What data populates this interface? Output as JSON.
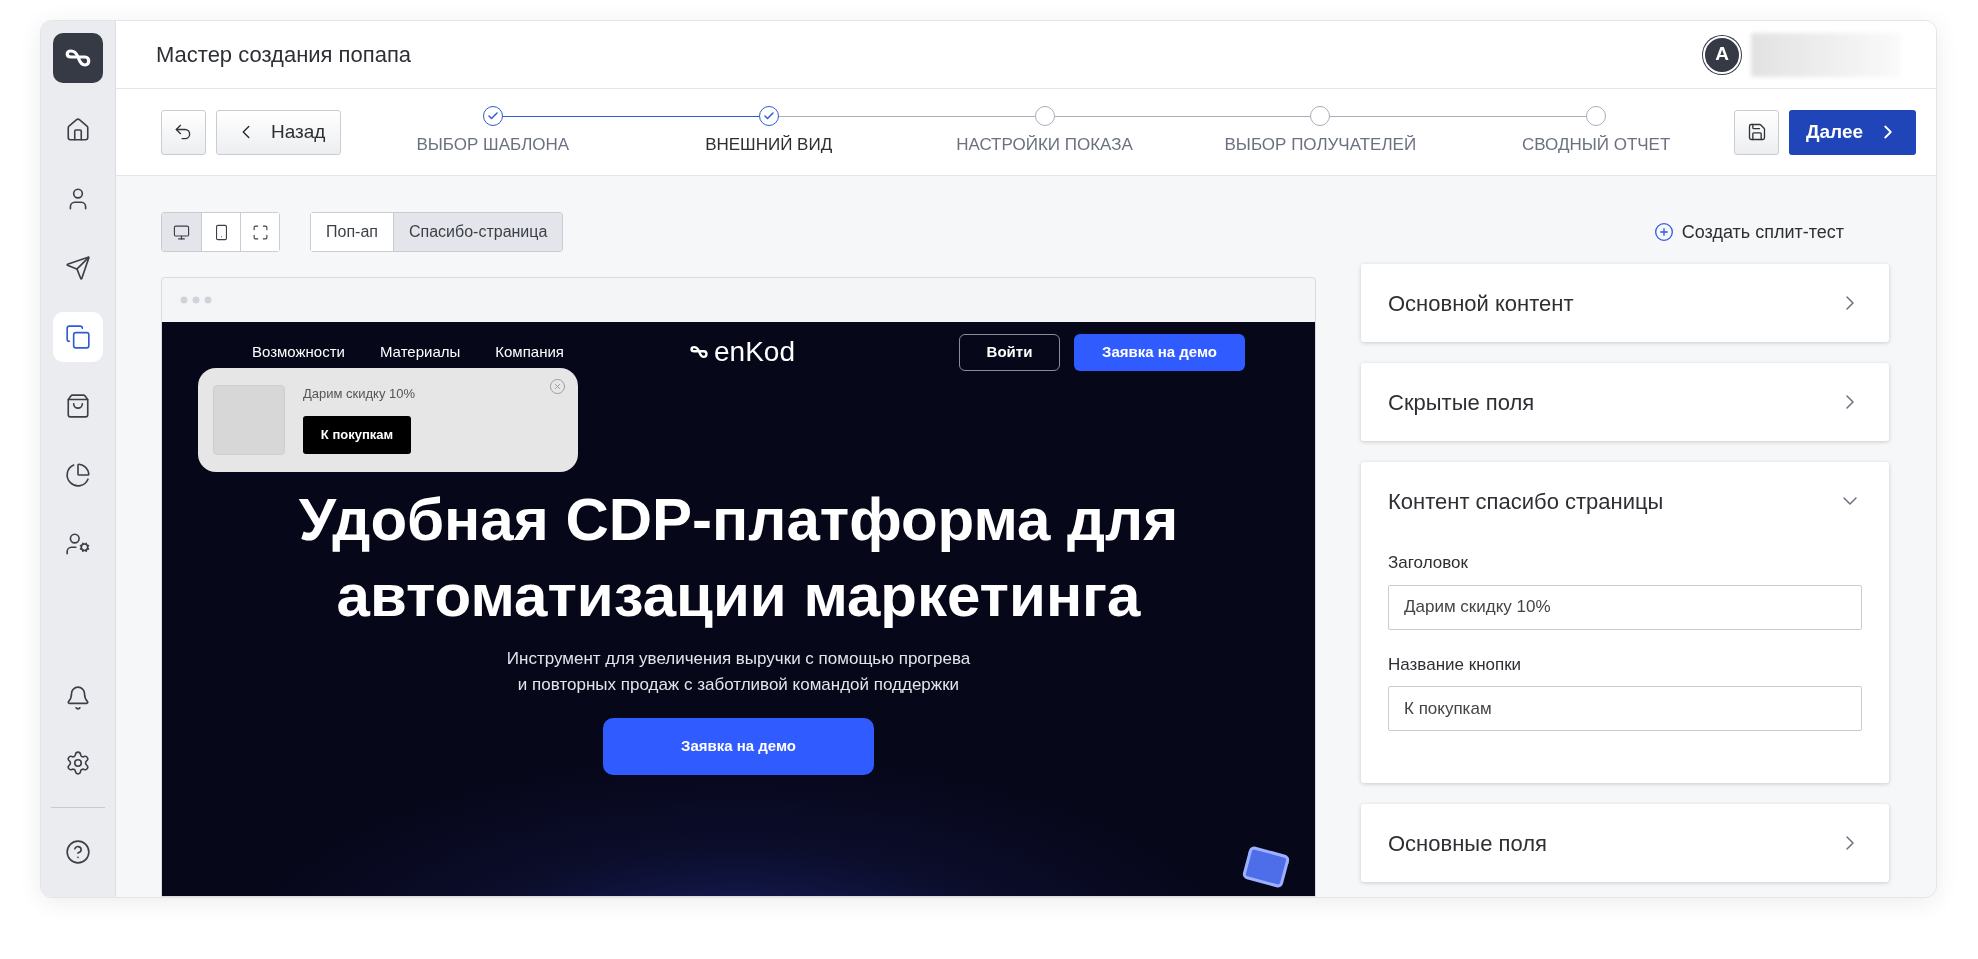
{
  "window": {
    "title": "Мастер создания попапа"
  },
  "user": {
    "avatar_letter": "A"
  },
  "sidebar": {
    "items": [
      {
        "selected": false
      },
      {
        "selected": false
      },
      {
        "selected": false
      },
      {
        "selected": true
      },
      {
        "selected": false
      },
      {
        "selected": false
      },
      {
        "selected": false
      }
    ],
    "bottom_items": [
      {
        "selected": false
      },
      {
        "selected": false
      },
      {
        "selected": false
      }
    ]
  },
  "toolbar": {
    "back_button": "Назад",
    "next_button": "Далее"
  },
  "steps": [
    {
      "label": "ВЫБОР ШАБЛОНА",
      "done": true,
      "selected": false
    },
    {
      "label": "ВНЕШНИЙ ВИД",
      "done": true,
      "selected": true
    },
    {
      "label": "НАСТРОЙКИ ПОКАЗА",
      "done": false,
      "selected": false
    },
    {
      "label": "ВЫБОР ПОЛУЧАТЕЛЕЙ",
      "done": false,
      "selected": false
    },
    {
      "label": "СВОДНЫЙ ОТЧЕТ",
      "done": false,
      "selected": false
    }
  ],
  "view_modes": [
    {
      "selected": true
    },
    {
      "selected": false
    },
    {
      "selected": false
    }
  ],
  "tabs": [
    {
      "label": "Поп-ап",
      "selected": false
    },
    {
      "label": "Спасибо-страница",
      "selected": true
    }
  ],
  "split_test_link": "Создать сплит-тест",
  "preview": {
    "nav_links": [
      "Возможности",
      "Материалы",
      "Компания"
    ],
    "logo": "enKod",
    "login_button": "Войти",
    "demo_button": "Заявка на демо",
    "popup": {
      "text": "Дарим скидку 10%",
      "button": "К покупкам"
    },
    "headline": [
      "Удобная CDP-платформа для",
      "автоматизации маркетинга"
    ],
    "subtitle": [
      "Инструмент для увеличения выручки с помощью прогрева",
      "и повторных продаж с заботливой командой поддержки"
    ],
    "cta_button": "Заявка на демо"
  },
  "sections": [
    {
      "title": "Основной контент",
      "expanded": false
    },
    {
      "title": "Скрытые поля",
      "expanded": false
    },
    {
      "title": "Контент спасибо страницы",
      "expanded": true,
      "fields": [
        {
          "label": "Заголовок",
          "value": "Дарим скидку 10%"
        },
        {
          "label": "Название кнопки",
          "value": "К покупкам"
        }
      ]
    },
    {
      "title": "Основные поля",
      "expanded": false
    }
  ]
}
